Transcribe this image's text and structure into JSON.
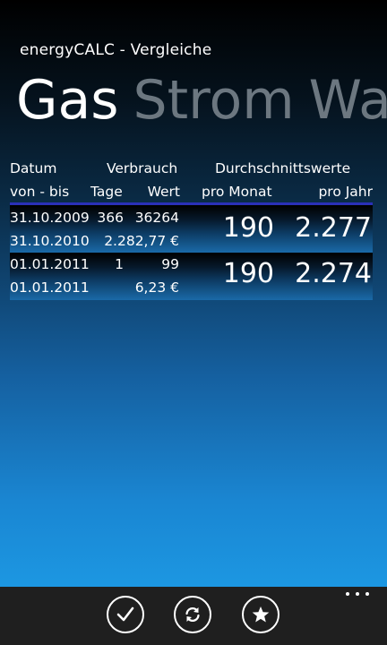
{
  "app": {
    "title": "energyCALC - Vergleiche"
  },
  "pivot": {
    "items": [
      "Gas",
      "Strom",
      "Wasser"
    ],
    "selected": "Gas"
  },
  "table": {
    "headers": {
      "datum": "Datum",
      "verbrauch": "Verbrauch",
      "durchschnitt": "Durchschnittswerte",
      "von_bis": "von - bis",
      "tage": "Tage",
      "wert": "Wert",
      "pro_monat": "pro Monat",
      "pro_jahr": "pro Jahr"
    },
    "rows": [
      {
        "von": "31.10.2009",
        "bis": "31.10.2010",
        "tage": "366",
        "verbrauch": "36264",
        "kosten": "2.282,77 €",
        "pro_monat": "190",
        "pro_jahr": "2.277"
      },
      {
        "von": "01.01.2011",
        "bis": "01.01.2011",
        "tage": "1",
        "verbrauch": "99",
        "kosten": "6,23 €",
        "pro_monat": "190",
        "pro_jahr": "2.274"
      }
    ]
  },
  "appbar": {
    "buttons": [
      {
        "icon": "check-icon"
      },
      {
        "icon": "refresh-icon"
      },
      {
        "icon": "star-icon"
      }
    ],
    "more_icon": "ellipsis-icon"
  }
}
